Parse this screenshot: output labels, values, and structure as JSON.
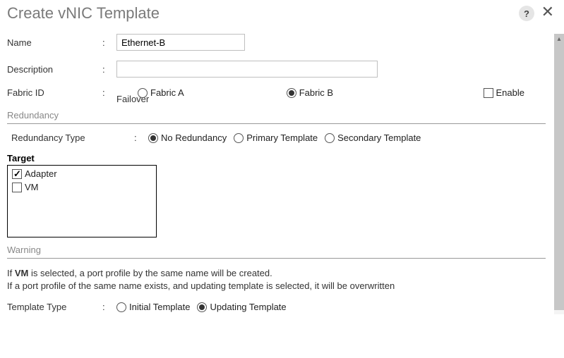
{
  "title": "Create vNIC Template",
  "help": "?",
  "form": {
    "name_label": "Name",
    "name_value": "Ethernet-B",
    "description_label": "Description",
    "description_value": "",
    "fabric_label": "Fabric ID",
    "fabric_a": "Fabric A",
    "fabric_b": "Fabric B",
    "enable_failover_label": "Enable Failover",
    "enable_left": "Enable",
    "failover_text": "Failover",
    "colon": ":"
  },
  "redundancy": {
    "section": "Redundancy",
    "type_label": "Redundancy Type",
    "options": {
      "no": "No Redundancy",
      "primary": "Primary Template",
      "secondary": "Secondary Template"
    }
  },
  "target": {
    "label": "Target",
    "adapter": "Adapter",
    "vm": "VM"
  },
  "warning": {
    "section": "Warning",
    "line1_a": "If ",
    "line1_b": "VM",
    "line1_c": " is selected, a port profile by the same name will be created.",
    "line2": "If a port profile of the same name exists, and updating template is selected, it will be overwritten"
  },
  "template_type": {
    "label": "Template Type",
    "initial": "Initial Template",
    "updating": "Updating Template"
  }
}
